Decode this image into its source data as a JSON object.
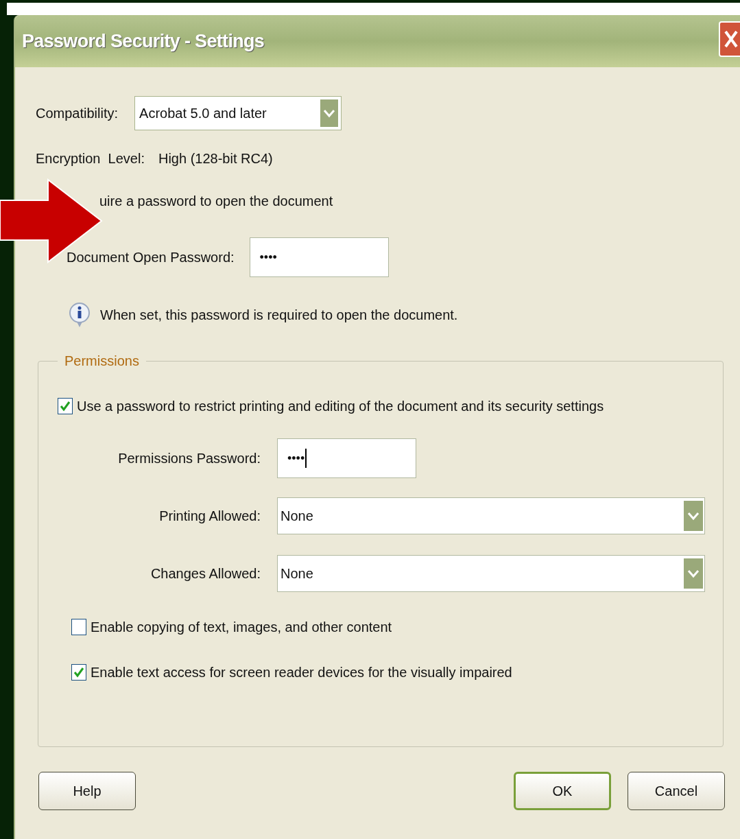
{
  "window": {
    "title": "Password Security - Settings"
  },
  "compatibility": {
    "label": "Compatibility:",
    "value": "Acrobat 5.0 and later"
  },
  "encryption": {
    "label": "Encryption  Level:",
    "value": "High (128-bit RC4)"
  },
  "open_password": {
    "checkbox_label": "uire a password to open the document",
    "field_label": "Document Open Password:",
    "value": "••••",
    "focused": false,
    "info": "When set, this password is required to open the document."
  },
  "permissions": {
    "legend": "Permissions",
    "restrict": {
      "label": "Use a password to restrict printing and editing of the document and its security settings",
      "checked": true
    },
    "password": {
      "label": "Permissions Password:",
      "value": "••••",
      "focused": true
    },
    "dropdowns": [
      {
        "label": "Printing Allowed:",
        "value": "None"
      },
      {
        "label": "Changes Allowed:",
        "value": "None"
      }
    ],
    "options": [
      {
        "label": "Enable copying of text, images, and other content",
        "checked": false
      },
      {
        "label": "Enable text access for screen reader devices for the visually impaired",
        "checked": true
      }
    ]
  },
  "buttons": [
    {
      "label": "Help",
      "default": false
    },
    {
      "label": "OK",
      "default": true
    },
    {
      "label": "Cancel",
      "default": false
    }
  ]
}
